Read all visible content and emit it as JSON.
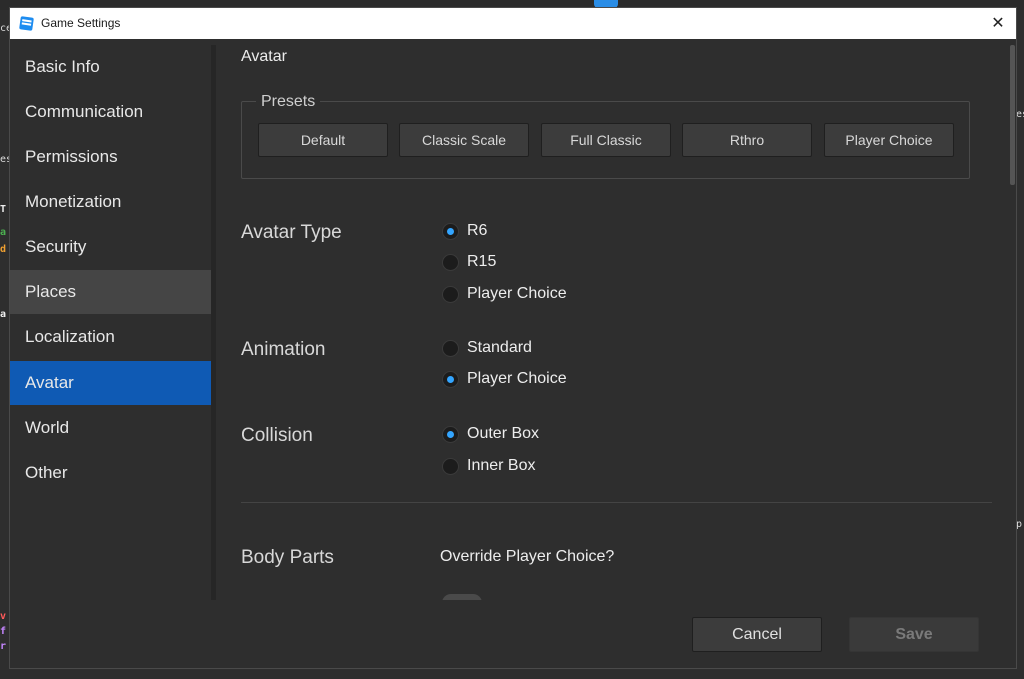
{
  "window": {
    "title": "Game Settings",
    "close_glyph": "✕"
  },
  "sidebar": {
    "items": [
      {
        "label": "Basic Info",
        "state": "normal"
      },
      {
        "label": "Communication",
        "state": "normal"
      },
      {
        "label": "Permissions",
        "state": "normal"
      },
      {
        "label": "Monetization",
        "state": "normal"
      },
      {
        "label": "Security",
        "state": "normal"
      },
      {
        "label": "Places",
        "state": "hover"
      },
      {
        "label": "Localization",
        "state": "normal"
      },
      {
        "label": "Avatar",
        "state": "active"
      },
      {
        "label": "World",
        "state": "normal"
      },
      {
        "label": "Other",
        "state": "normal"
      }
    ]
  },
  "main": {
    "title": "Avatar",
    "presets": {
      "legend": "Presets",
      "buttons": [
        "Default",
        "Classic Scale",
        "Full Classic",
        "Rthro",
        "Player Choice"
      ]
    },
    "avatar_type": {
      "label": "Avatar Type",
      "options": [
        {
          "label": "R6",
          "selected": true
        },
        {
          "label": "R15",
          "selected": false
        },
        {
          "label": "Player Choice",
          "selected": false
        }
      ]
    },
    "animation": {
      "label": "Animation",
      "options": [
        {
          "label": "Standard",
          "selected": false
        },
        {
          "label": "Player Choice",
          "selected": true
        }
      ]
    },
    "collision": {
      "label": "Collision",
      "options": [
        {
          "label": "Outer Box",
          "selected": true
        },
        {
          "label": "Inner Box",
          "selected": false
        }
      ]
    },
    "body_parts": {
      "label": "Body Parts",
      "override_label": "Override Player Choice?",
      "override_enabled": false
    }
  },
  "footer": {
    "cancel_label": "Cancel",
    "save_label": "Save",
    "save_enabled": false
  },
  "colors": {
    "accent": "#0f5ab4",
    "radio_selected": "#33a5ff"
  },
  "background_fragments": [
    "ce",
    "es",
    "T",
    "a",
    "d",
    "a",
    "v",
    "f",
    "r",
    "es",
    "p"
  ]
}
